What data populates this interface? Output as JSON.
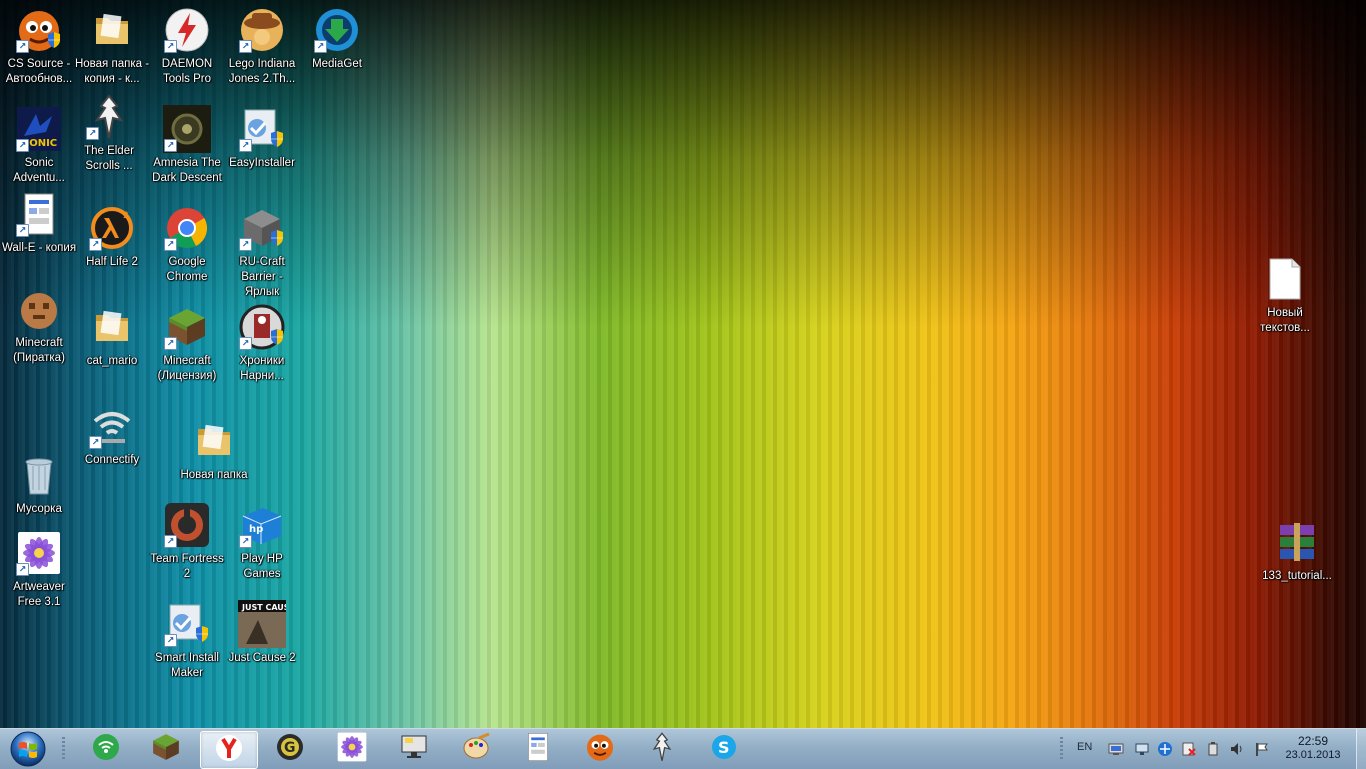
{
  "desktop": {
    "icons": [
      {
        "id": "cs-source",
        "label": "CS Source - Автообнов...",
        "icon": "bot-face-icon",
        "color": "#e36a17"
      },
      {
        "id": "new-folder-copy",
        "label": "Новая папка - копия - к...",
        "icon": "folder-icon",
        "color": "#e9c46a"
      },
      {
        "id": "daemon-tools",
        "label": "DAEMON Tools Pro",
        "icon": "lightning-disc-icon",
        "color": "#d62828"
      },
      {
        "id": "lego-indiana",
        "label": "Lego Indiana Jones 2.Th...",
        "icon": "lego-hat-icon",
        "color": "#8a4b1f"
      },
      {
        "id": "mediaget",
        "label": "MediaGet",
        "icon": "download-arrow-icon",
        "color": "#2aa84a"
      },
      {
        "id": "sonic",
        "label": "Sonic Adventu...",
        "icon": "sonic-icon",
        "color": "#1f4fbf"
      },
      {
        "id": "elder-scrolls",
        "label": "The Elder Scrolls ...",
        "icon": "dragon-emblem-icon",
        "color": "#444444"
      },
      {
        "id": "amnesia",
        "label": "Amnesia The Dark Descent",
        "icon": "amnesia-icon",
        "color": "#3a3a22"
      },
      {
        "id": "easyinstaller",
        "label": "EasyInstaller",
        "icon": "installer-icon",
        "color": "#4a90d9"
      },
      {
        "id": "wall-e",
        "label": "Wall-E - копия",
        "icon": "document-icon",
        "color": "#3a6fd8"
      },
      {
        "id": "half-life-2",
        "label": "Half Life 2",
        "icon": "lambda-icon",
        "color": "#f28c1c"
      },
      {
        "id": "google-chrome",
        "label": "Google Chrome",
        "icon": "chrome-icon",
        "color": "#db4437"
      },
      {
        "id": "ru-craft",
        "label": "RU-Craft Barrier - Ярлык",
        "icon": "stone-block-icon",
        "color": "#6b6b6b"
      },
      {
        "id": "minecraft-pirate",
        "label": "Minecraft (Пиратка)",
        "icon": "minecraft-face-icon",
        "color": "#b97a45"
      },
      {
        "id": "cat-mario",
        "label": "cat_mario",
        "icon": "folder-icon",
        "color": "#e9c46a"
      },
      {
        "id": "minecraft-license",
        "label": "Minecraft (Лицензия)",
        "icon": "grass-block-icon",
        "color": "#5b8c2a"
      },
      {
        "id": "narnia",
        "label": "Хроники Нарни...",
        "icon": "narnia-icon",
        "color": "#9a2a2a"
      },
      {
        "id": "connectify",
        "label": "Connectify",
        "icon": "wifi-hand-icon",
        "color": "#dddddd"
      },
      {
        "id": "recycle-bin",
        "label": "Мусорка",
        "icon": "recycle-bin-icon",
        "color": "#9fb6c8"
      },
      {
        "id": "new-folder",
        "label": "Новая папка",
        "icon": "folder-icon",
        "color": "#e9c46a"
      },
      {
        "id": "artweaver",
        "label": "Artweaver Free 3.1",
        "icon": "flower-icon",
        "color": "#8a4fd8"
      },
      {
        "id": "team-fortress",
        "label": "Team Fortress 2",
        "icon": "tf2-icon",
        "color": "#c1502e"
      },
      {
        "id": "play-hp-games",
        "label": "Play HP Games",
        "icon": "hp-box-icon",
        "color": "#1e7fd6"
      },
      {
        "id": "smart-install",
        "label": "Smart Install Maker",
        "icon": "installer-icon",
        "color": "#4a90d9"
      },
      {
        "id": "just-cause-2",
        "label": "Just Cause 2",
        "icon": "just-cause-icon",
        "color": "#7a6a55"
      },
      {
        "id": "new-text-doc",
        "label": "Новый текстов...",
        "icon": "text-file-icon",
        "color": "#ffffff"
      },
      {
        "id": "rar-archive",
        "label": "133_tutorial...",
        "icon": "winrar-icon",
        "color": "#7b3fb0"
      }
    ]
  },
  "taskbar": {
    "start_icon": "windows-orb-icon",
    "buttons": [
      {
        "id": "connectify",
        "icon": "wifi-broadcast-icon",
        "color": "#2ea84a"
      },
      {
        "id": "minecraft",
        "icon": "grass-block-icon",
        "color": "#5b8c2a"
      },
      {
        "id": "yandex",
        "icon": "yandex-y-icon",
        "color": "#e5231e"
      },
      {
        "id": "garena",
        "icon": "g-gear-icon",
        "color": "#2b2b2b"
      },
      {
        "id": "artweaver",
        "icon": "flower-icon",
        "color": "#8a4fd8"
      },
      {
        "id": "monitor",
        "icon": "monitor-icon",
        "color": "#333333"
      },
      {
        "id": "paint",
        "icon": "palette-icon",
        "color": "#d88a2a"
      },
      {
        "id": "document",
        "icon": "document-icon",
        "color": "#3a6fd8"
      },
      {
        "id": "cs-bot",
        "icon": "bot-face-icon",
        "color": "#e36a17"
      },
      {
        "id": "skyrim",
        "icon": "dragon-emblem-icon",
        "color": "#444444"
      },
      {
        "id": "skype",
        "icon": "skype-icon",
        "color": "#1aa6e8"
      }
    ],
    "language": "EN",
    "clock_time": "22:59",
    "clock_date": "23.01.2013"
  }
}
